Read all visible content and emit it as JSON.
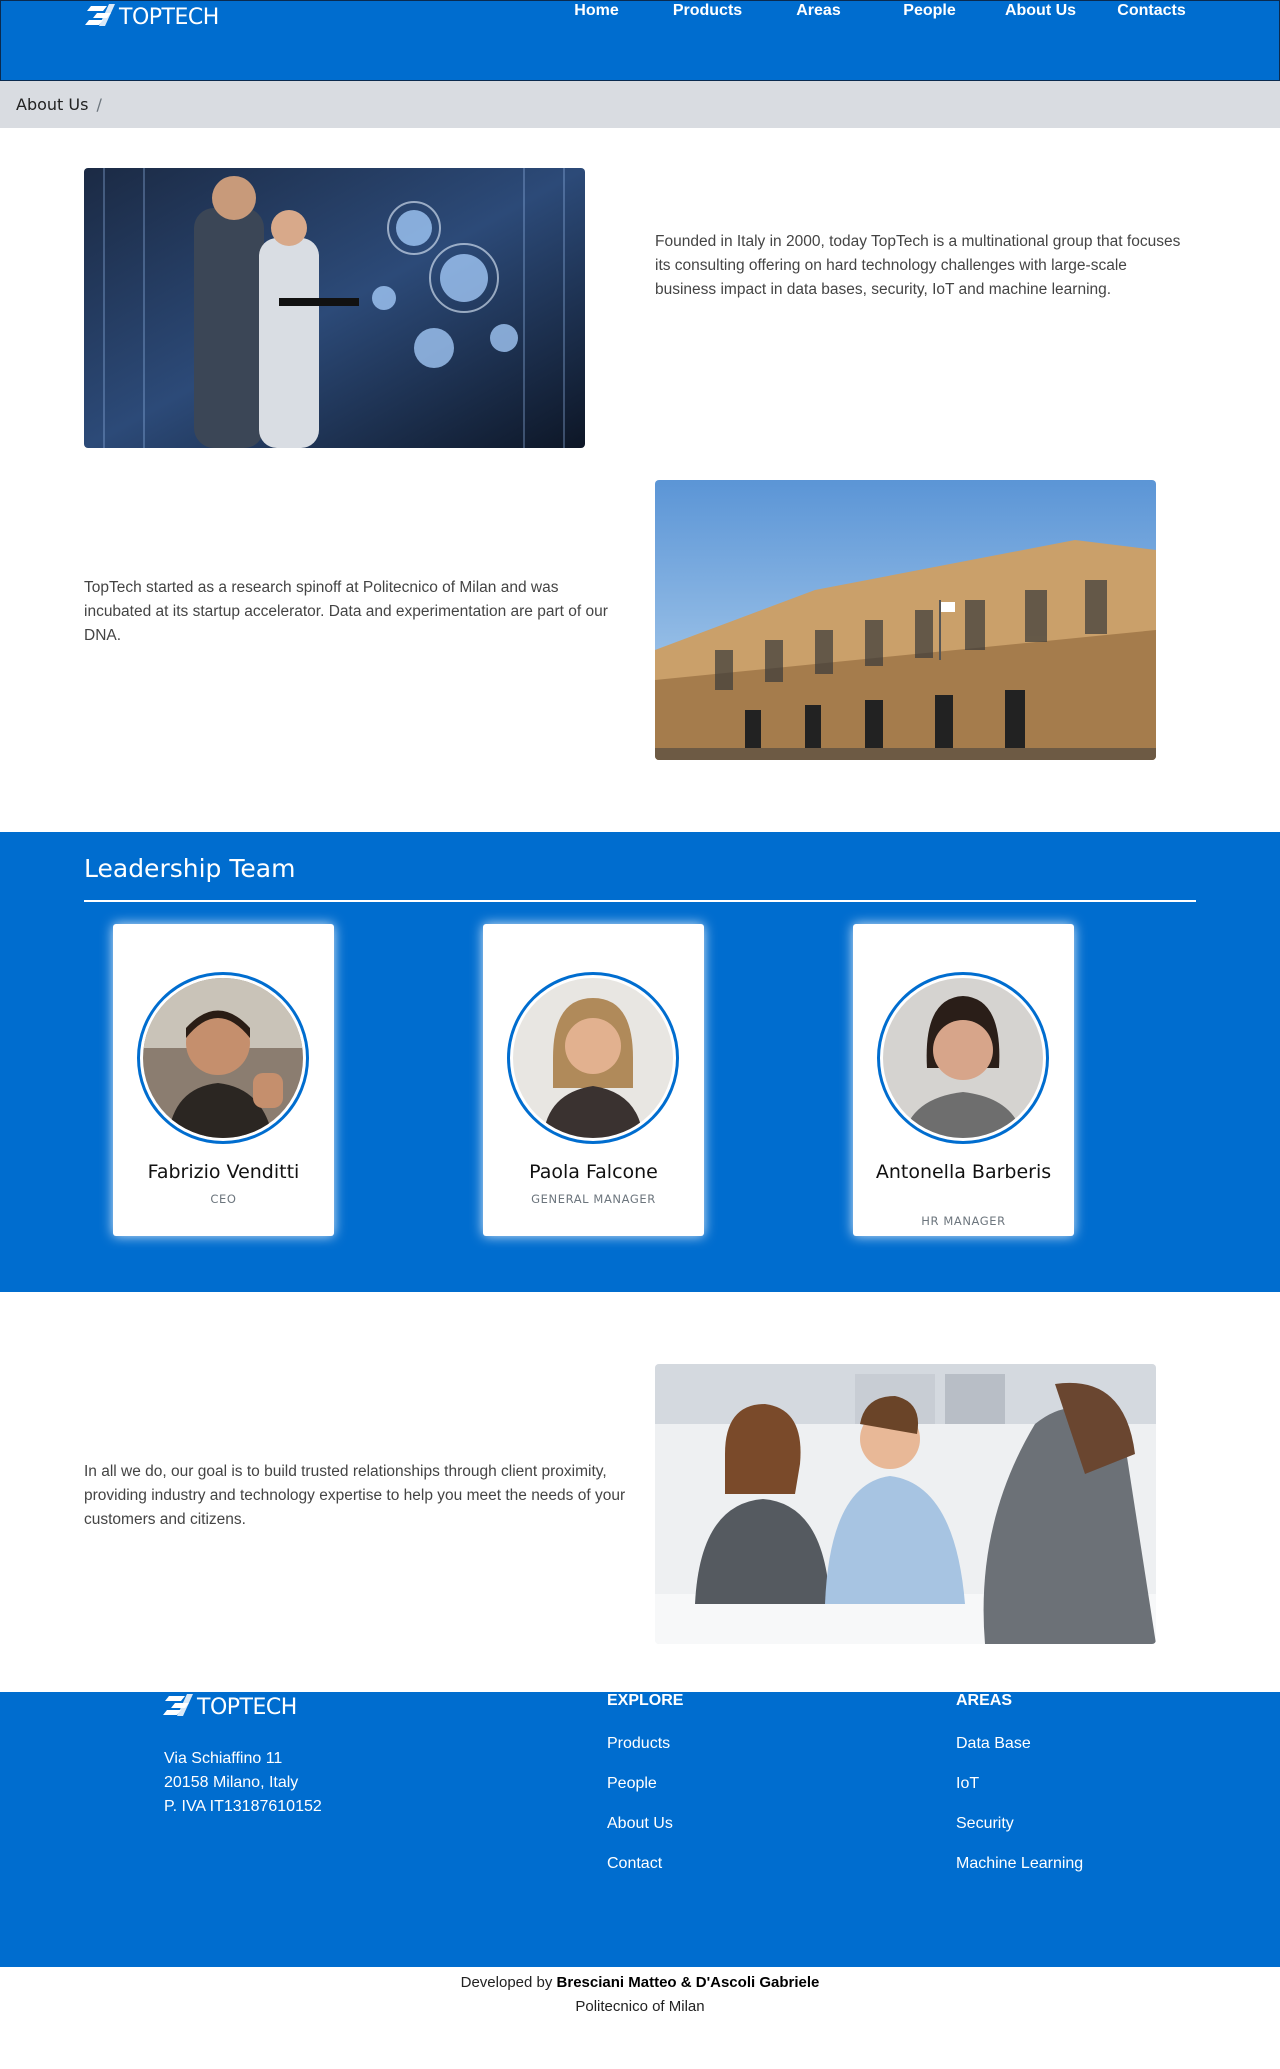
{
  "brand": {
    "name": "TOPTECH"
  },
  "nav": {
    "items": [
      "Home",
      "Products",
      "Areas",
      "People",
      "About Us",
      "Contacts"
    ]
  },
  "breadcrumb": {
    "current": "About Us",
    "separator": "/"
  },
  "about": {
    "paragraph1": "Founded in Italy in 2000, today TopTech is a multinational group that focuses its consulting offering on hard technology challenges with large-scale business impact in data bases, security, IoT and machine learning.",
    "paragraph2": "TopTech started as a research spinoff at Politecnico of Milan and was incubated at its startup accelerator. Data and experimentation are part of our DNA.",
    "paragraph3": "In all we do, our goal is to build trusted relationships through client proximity, providing industry and technology expertise to help you meet the needs of your customers and citizens."
  },
  "team": {
    "title": "Leadership Team",
    "members": [
      {
        "name": "Fabrizio Venditti",
        "role": "CEO"
      },
      {
        "name": "Paola Falcone",
        "role": "General Manager"
      },
      {
        "name": "Antonella Barberis",
        "role": "HR Manager"
      }
    ]
  },
  "footer": {
    "address": [
      "Via Schiaffino 11",
      "20158 Milano, Italy",
      "P. IVA IT13187610152"
    ],
    "explore": {
      "title": "Explore",
      "links": [
        "Products",
        "People",
        "About Us",
        "Contact"
      ]
    },
    "areas": {
      "title": "Areas",
      "links": [
        "Data Base",
        "IoT",
        "Security",
        "Machine Learning"
      ]
    }
  },
  "credits": {
    "prefix": "Developed by",
    "authors": "Bresciani Matteo & D'Ascoli Gabriele",
    "institution": "Politecnico of Milan"
  },
  "colors": {
    "primary": "#006dcf",
    "breadcrumb_bg": "#d9dce1",
    "text": "#444444"
  }
}
